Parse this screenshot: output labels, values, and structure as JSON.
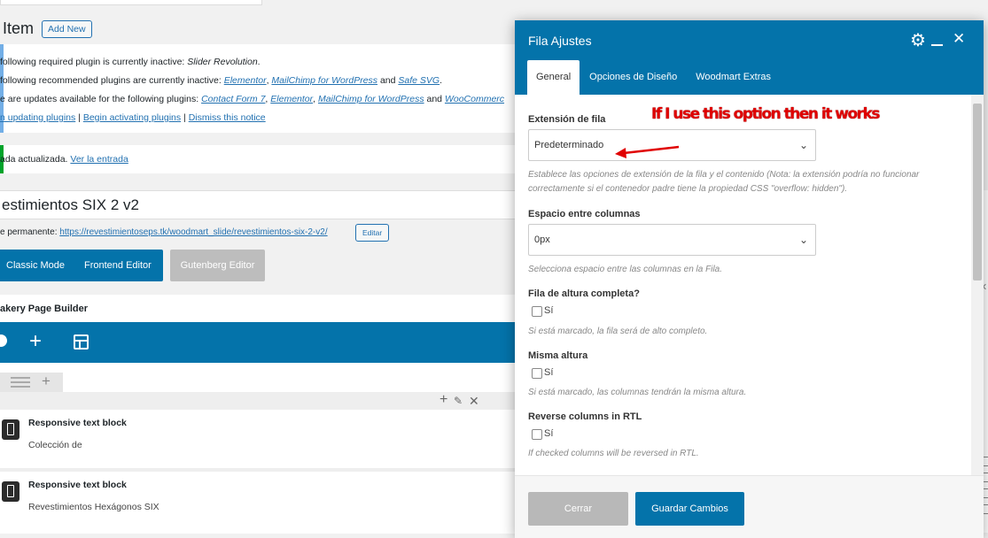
{
  "header": {
    "title": "Item",
    "add_new": "Add New"
  },
  "notices": {
    "line1_prefix": "following required plugin is currently inactive: ",
    "line1_plugin": "Slider Revolution",
    "line1_suffix": ".",
    "line2_prefix": "following recommended plugins are currently inactive: ",
    "line2_p1": "Elementor",
    "line2_p2": "MailChimp for WordPress",
    "line2_and": " and ",
    "line2_p3": "Safe SVG",
    "line2_suffix": ".",
    "line3_prefix": "e are updates available for the following plugins: ",
    "line3_p1": "Contact Form 7",
    "line3_p2": "Elementor",
    "line3_p3": "MailChimp for WordPress",
    "line3_and": " and ",
    "line3_p4": "WooCommerc",
    "link_updating": "n updating plugins",
    "link_activating": "Begin activating plugins",
    "link_dismiss": "Dismiss this notice",
    "sep": " | "
  },
  "updated": {
    "text": "ada actualizada. ",
    "link": "Ver la entrada"
  },
  "post": {
    "title": "estimientos SIX 2 v2",
    "permalink_label": "e permanente: ",
    "permalink_url": "https://revestimientoseps.tk/woodmart_slide/revestimientos-six-2-v2/",
    "edit_btn": "Editar"
  },
  "editor_buttons": {
    "classic": "Classic Mode",
    "frontend": "Frontend Editor",
    "gutenberg": "Gutenberg Editor"
  },
  "builder": {
    "title": "akery Page Builder",
    "elements": [
      {
        "title": "Responsive text block",
        "subtitle": "Colección de"
      },
      {
        "title": "Responsive text block",
        "subtitle": "Revestimientos Hexágonos SIX"
      }
    ]
  },
  "modal": {
    "title": "Fila Ajustes",
    "tabs": [
      "General",
      "Opciones de Diseño",
      "Woodmart Extras"
    ],
    "fields": {
      "ext_label": "Extensión de fila",
      "ext_value": "Predeterminado",
      "ext_help": "Establece las opciones de extensión de la fila y el contenido (Nota: la extensión podría no funcionar correctamente si el contenedor padre tiene la propiedad CSS \"overflow: hidden\").",
      "gap_label": "Espacio entre columnas",
      "gap_value": "0px",
      "gap_help": "Selecciona espacio entre las columnas en la Fila.",
      "full_label": "Fila de altura completa?",
      "full_cb": "Sí",
      "full_help": "Si está marcado, la fila será de alto completo.",
      "eq_label": "Misma altura",
      "eq_cb": "Sí",
      "eq_help": "Si está marcado, las columnas tendrán la misma altura.",
      "rtl_label": "Reverse columns in RTL",
      "rtl_cb": "Sí",
      "rtl_help": "If checked columns will be reversed in RTL."
    },
    "close_btn": "Cerrar",
    "save_btn": "Guardar Cambios"
  },
  "annotation": "If I use this option then it works",
  "colors": {
    "accent": "#0473aa",
    "annotation": "#e00000"
  }
}
